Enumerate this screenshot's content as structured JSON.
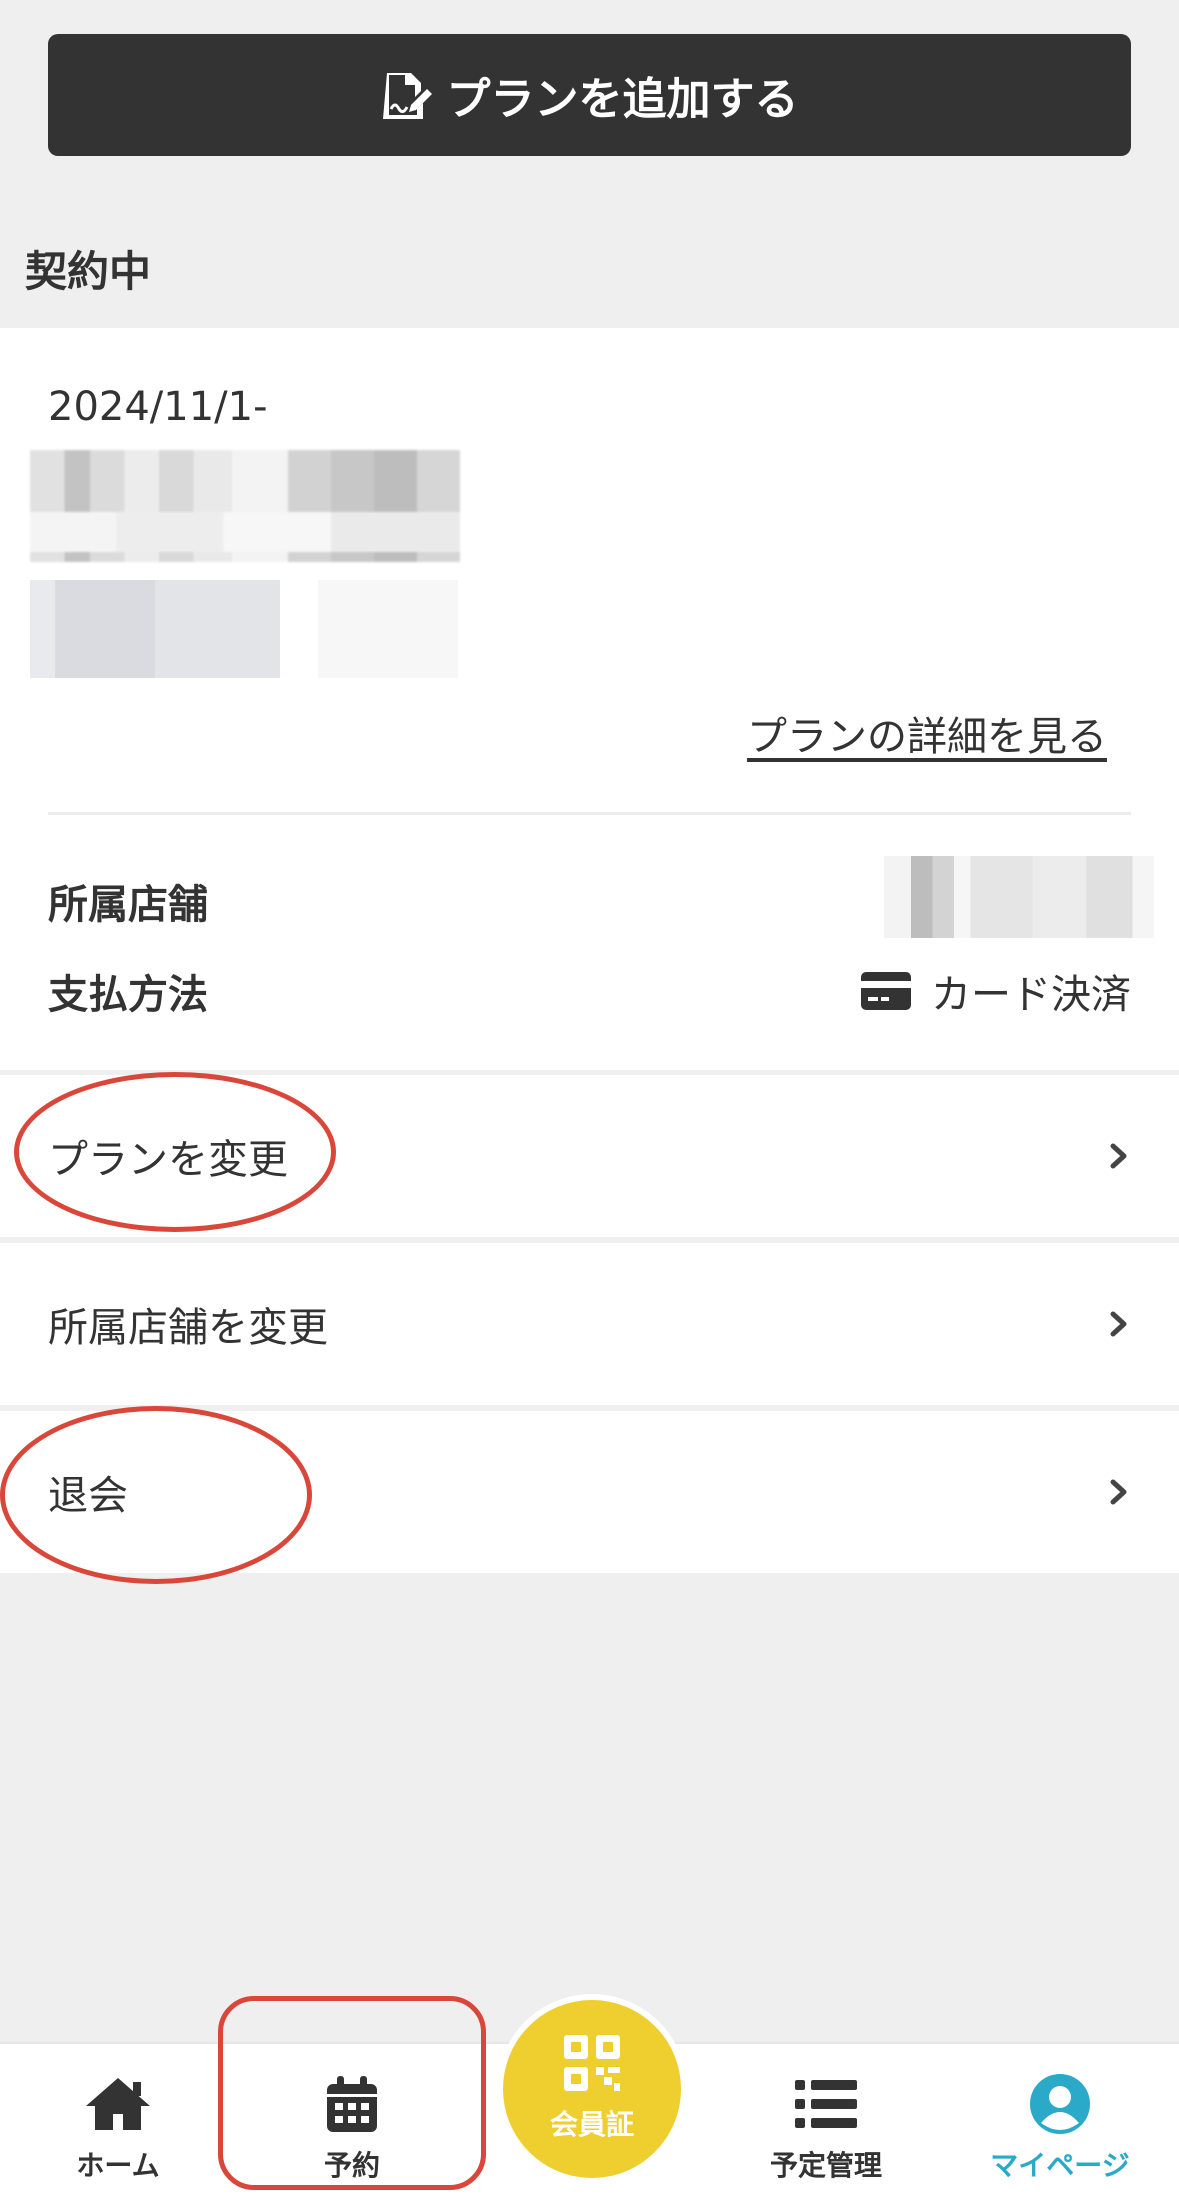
{
  "add_plan_button": {
    "label": "プランを追加する",
    "icon": "document-edit-icon"
  },
  "section": {
    "title": "契約中"
  },
  "contract": {
    "date": "2024/11/1-",
    "detail_link": "プランの詳細を見る",
    "store_label": "所属店舗",
    "payment_label": "支払方法",
    "payment_value": "カード決済",
    "payment_icon": "credit-card-icon"
  },
  "menu": [
    {
      "label": "プランを変更"
    },
    {
      "label": "所属店舗を変更"
    },
    {
      "label": "退会"
    }
  ],
  "tabbar": {
    "items": [
      {
        "label": "ホーム",
        "icon": "home-icon"
      },
      {
        "label": "予約",
        "icon": "calendar-icon"
      },
      {
        "label": "会員証",
        "icon": "qr-code-icon"
      },
      {
        "label": "予定管理",
        "icon": "list-icon"
      },
      {
        "label": "マイページ",
        "icon": "user-circle-icon",
        "active": true
      }
    ]
  },
  "colors": {
    "primary_dark": "#333333",
    "background": "#efefef",
    "annotation": "#d9473a",
    "accent_yellow": "#efce2f",
    "active_tab": "#2aa9c9"
  }
}
